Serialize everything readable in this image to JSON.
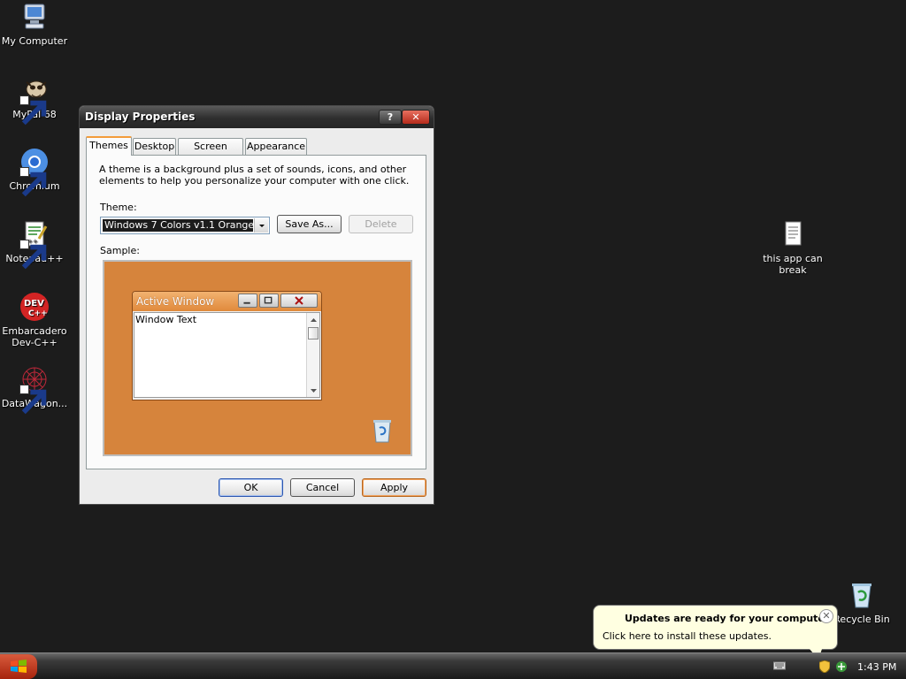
{
  "desktop": {
    "icons": [
      {
        "label": "My Computer"
      },
      {
        "label": "MyPal 68"
      },
      {
        "label": "Chromium"
      },
      {
        "label": "Notepad++"
      },
      {
        "label": "Embarcadero Dev-C++"
      },
      {
        "label": "DataWagon..."
      },
      {
        "label": "this app can break"
      },
      {
        "label": "Recycle Bin"
      }
    ]
  },
  "window": {
    "title": "Display Properties",
    "help_label": "?",
    "close_label": "✕",
    "tabs": [
      {
        "label": "Themes",
        "active": true
      },
      {
        "label": "Desktop"
      },
      {
        "label": "Screen Saver"
      },
      {
        "label": "Appearance"
      }
    ],
    "description": "A theme is a background plus a set of sounds, icons, and other elements to help you personalize your computer with one click.",
    "theme_label": "Theme:",
    "theme_value": "Windows 7 Colors v1.1 Orange",
    "save_as_label": "Save As...",
    "delete_label": "Delete",
    "sample_label": "Sample:",
    "sample": {
      "window_title": "Active Window",
      "window_text": "Window Text",
      "background_color": "#d6843c"
    },
    "buttons": {
      "ok": "OK",
      "cancel": "Cancel",
      "apply": "Apply"
    }
  },
  "taskbar": {
    "clock": "1:43 PM"
  },
  "balloon": {
    "title": "Updates are ready for your computer",
    "text": "Click here to install these updates.",
    "close_label": "✕"
  }
}
